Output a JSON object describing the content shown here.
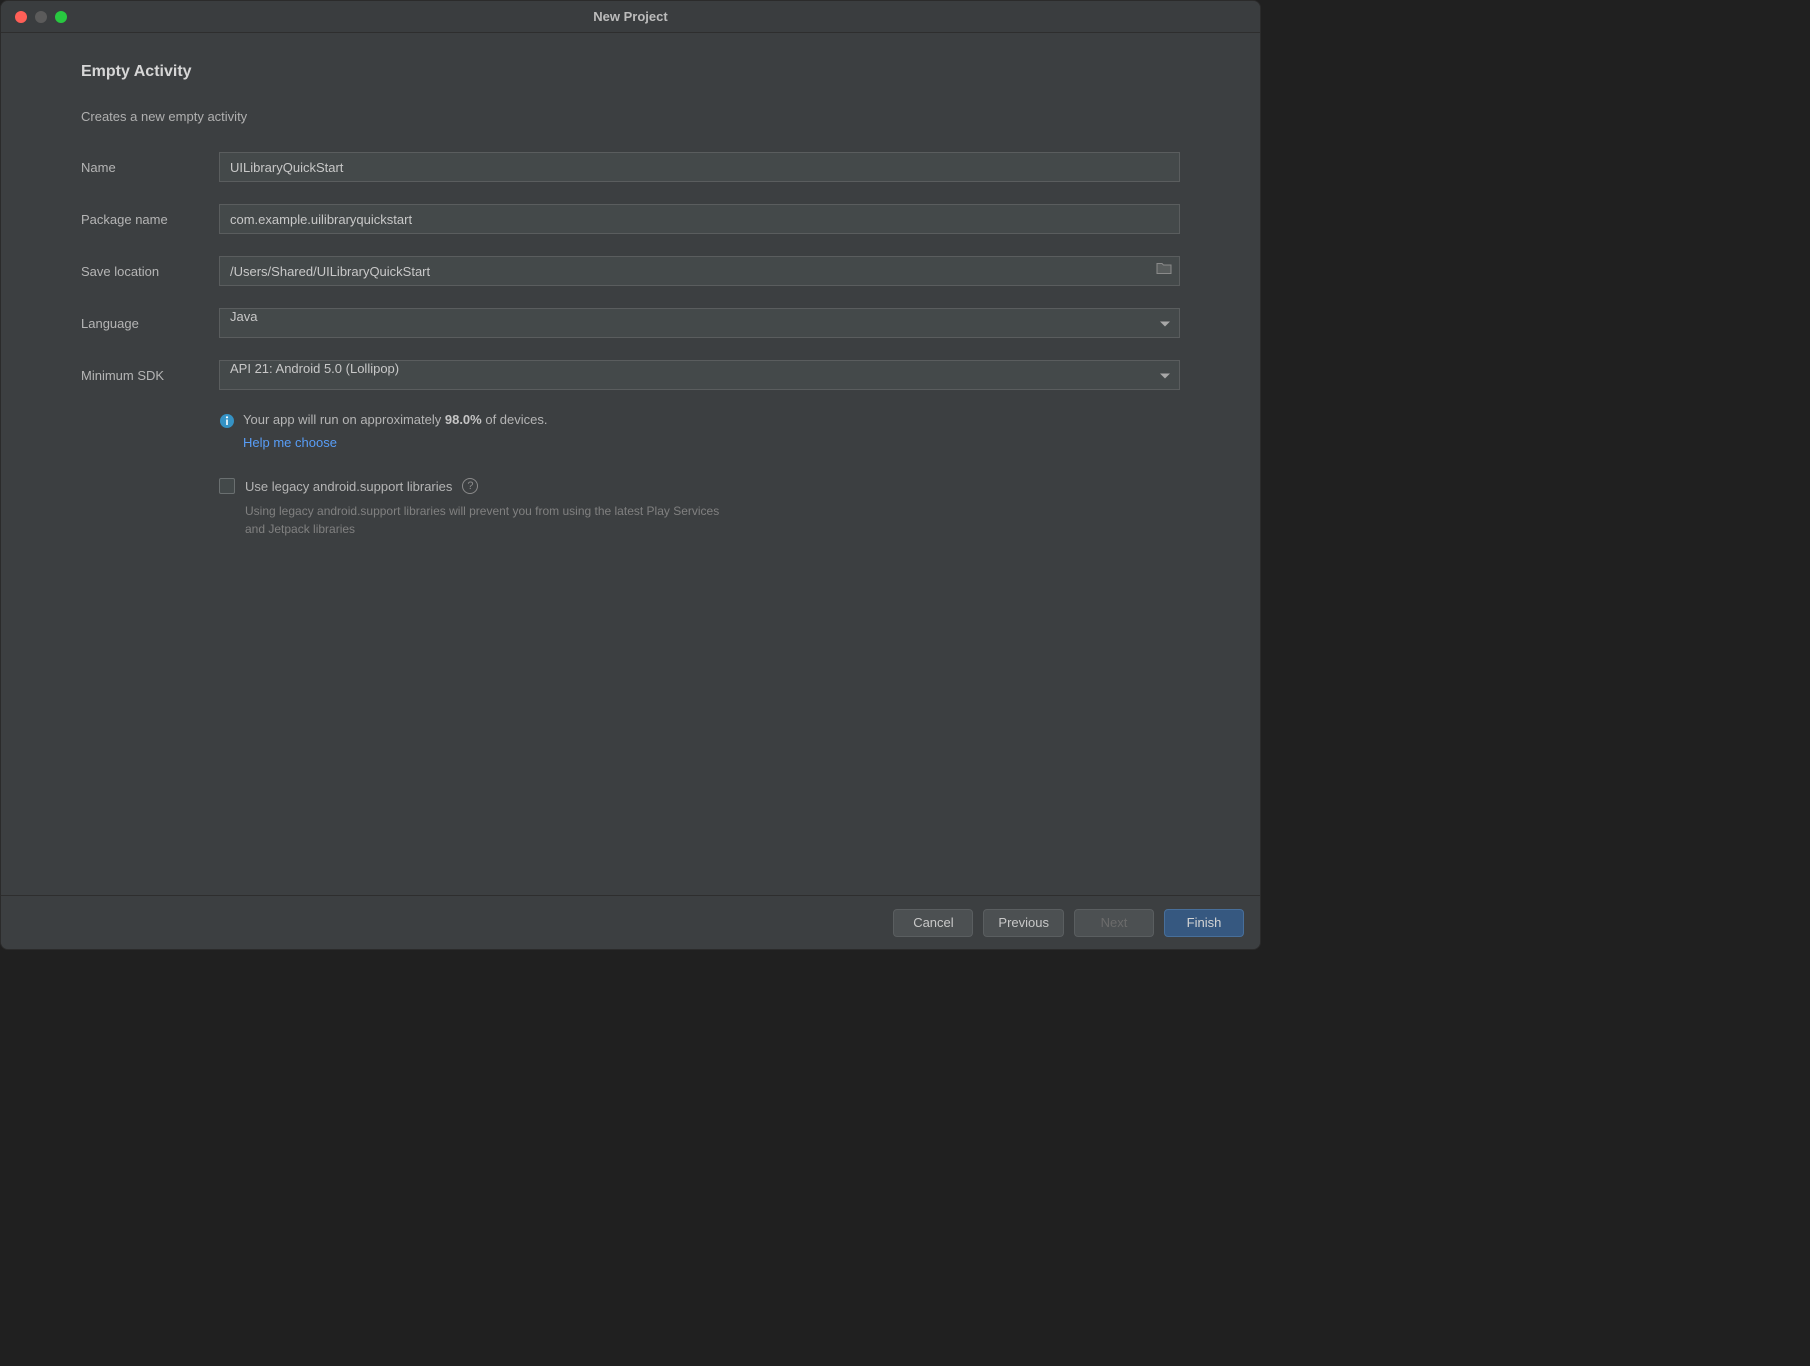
{
  "window": {
    "title": "New Project"
  },
  "page": {
    "heading": "Empty Activity",
    "subheading": "Creates a new empty activity"
  },
  "form": {
    "name_label": "Name",
    "name_value": "UILibraryQuickStart",
    "package_label": "Package name",
    "package_value": "com.example.uilibraryquickstart",
    "location_label": "Save location",
    "location_value": "/Users/Shared/UILibraryQuickStart",
    "language_label": "Language",
    "language_value": "Java",
    "sdk_label": "Minimum SDK",
    "sdk_value": "API 21: Android 5.0 (Lollipop)"
  },
  "info": {
    "text_prefix": "Your app will run on approximately ",
    "percent": "98.0%",
    "text_suffix": " of devices.",
    "help_link": "Help me choose"
  },
  "legacy": {
    "label": "Use legacy android.support libraries",
    "hint": "Using legacy android.support libraries will prevent you from using the latest Play Services and Jetpack libraries"
  },
  "footer": {
    "cancel": "Cancel",
    "previous": "Previous",
    "next": "Next",
    "finish": "Finish"
  }
}
